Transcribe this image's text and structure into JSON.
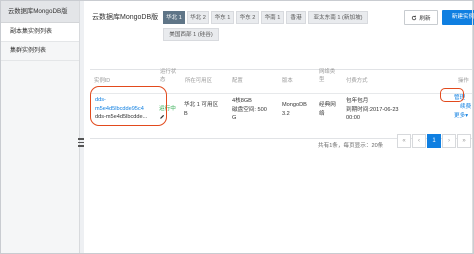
{
  "sidebar": {
    "title": "云数据库MongoDB版",
    "items": [
      {
        "label": "副本集实例列表",
        "active": true
      },
      {
        "label": "集群实例列表",
        "active": false
      }
    ]
  },
  "header": {
    "title": "云数据库MongoDB版",
    "regions": [
      {
        "label": "华北 1",
        "active": true
      },
      {
        "label": "华北 2",
        "active": false
      },
      {
        "label": "华东 1",
        "active": false
      },
      {
        "label": "华东 2",
        "active": false
      },
      {
        "label": "华南 1",
        "active": false
      },
      {
        "label": "香港",
        "active": false
      },
      {
        "label": "亚太东南 1 (新加坡)",
        "active": false
      },
      {
        "label": "美国西部 1 (硅谷)",
        "active": false
      }
    ],
    "refresh_label": "刷新",
    "create_label": "新建实例"
  },
  "table": {
    "headers": [
      "实例ID",
      "运行状态",
      "所在可用区",
      "配置",
      "版本",
      "网络类型",
      "付费方式",
      "操作"
    ],
    "headers_lines": {
      "status": [
        "运行状",
        "态"
      ],
      "network": [
        "网络类",
        "型"
      ]
    },
    "rows": [
      {
        "id_lines": [
          "dds-",
          "m5e4d5lbcdde95c4",
          "dds-m5e4d5lbcdde..."
        ],
        "status": "运行中",
        "zone": "华北 1 可用区 B",
        "zone_lines": [
          "华北 1 可用区",
          "B"
        ],
        "config_lines": [
          "4核8GB",
          "磁盘空间: 500",
          "G"
        ],
        "version_lines": [
          "MongoDB",
          "3.2"
        ],
        "network_lines": [
          "经典网",
          "络"
        ],
        "billing_lines": [
          "包年包月",
          "到期时间:2017-06-23",
          "00:00"
        ],
        "ops": [
          "管理",
          "续费",
          "更多"
        ]
      }
    ]
  },
  "pagination": {
    "summary": "共有1条，每页显示：20条",
    "first": "«",
    "prev": "‹",
    "current": "1",
    "next": "›",
    "last": "»"
  },
  "colors": {
    "accent": "#0f7fe1",
    "active_tab": "#5f7587",
    "running": "#2aa94b",
    "highlight": "#e24a1d"
  }
}
